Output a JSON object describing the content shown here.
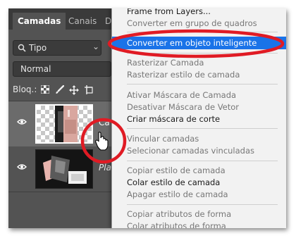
{
  "layers_panel": {
    "tabs": [
      "Camadas",
      "Canais",
      "D"
    ],
    "filter_label": "Tipo",
    "blend_mode": "Normal",
    "lock_label": "Bloq.:",
    "layers": [
      {
        "name": "Ca",
        "visible": true,
        "selected": true
      },
      {
        "name": "Pla",
        "visible": true,
        "selected": false
      }
    ]
  },
  "context_menu": {
    "groups": [
      {
        "items": [
          {
            "label": "Frame from Layers...",
            "disabled": false
          },
          {
            "label": "Converter em grupo de quadros",
            "disabled": true
          }
        ]
      },
      {
        "items": [
          {
            "label": "Converter em objeto inteligente",
            "disabled": false,
            "highlighted": true
          }
        ]
      },
      {
        "items": [
          {
            "label": "Rasterizar Camada",
            "disabled": true
          },
          {
            "label": "Rasterizar estilo de camada",
            "disabled": true
          }
        ]
      },
      {
        "items": [
          {
            "label": "Ativar Máscara de Camada",
            "disabled": true
          },
          {
            "label": "Desativar Máscara de Vetor",
            "disabled": true
          },
          {
            "label": "Criar máscara de corte",
            "disabled": false
          }
        ]
      },
      {
        "items": [
          {
            "label": "Vincular camadas",
            "disabled": true
          },
          {
            "label": "Selecionar camadas vinculadas",
            "disabled": true
          }
        ]
      },
      {
        "items": [
          {
            "label": "Copiar estilo de camada",
            "disabled": true
          },
          {
            "label": "Colar estilo de camada",
            "disabled": false
          },
          {
            "label": "Apagar estilo de camada",
            "disabled": true
          }
        ]
      },
      {
        "items": [
          {
            "label": "Copiar atributos de forma",
            "disabled": true
          },
          {
            "label": "Colar atributos de forma",
            "disabled": true
          }
        ]
      }
    ]
  },
  "colors": {
    "panel_bg": "#535353",
    "menu_bg": "#f2f2f2",
    "highlight": "#1a73e8",
    "annotation_red": "#e01b24"
  },
  "icons": {
    "visibility": "eye-icon",
    "filter": "search-icon",
    "cursor": "hand-pointer-icon",
    "locks": [
      "lock-transparent-pixels-icon",
      "lock-image-pixels-icon",
      "lock-position-icon",
      "lock-artboard-icon"
    ]
  }
}
